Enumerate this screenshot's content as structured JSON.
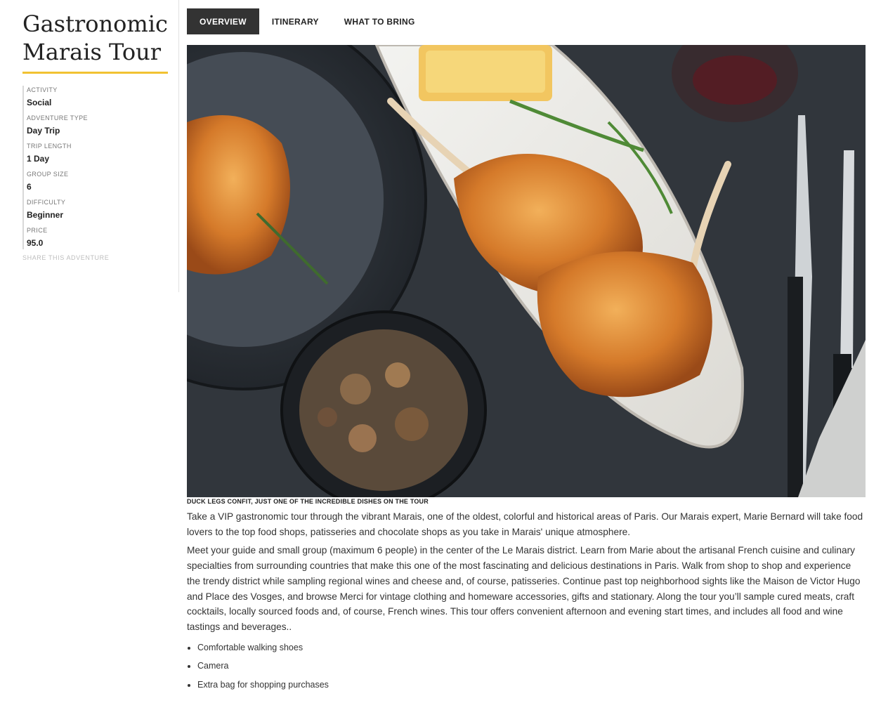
{
  "title": "Gastronomic Marais Tour",
  "facts": [
    {
      "label": "ACTIVITY",
      "value": "Social"
    },
    {
      "label": "ADVENTURE TYPE",
      "value": "Day Trip"
    },
    {
      "label": "TRIP LENGTH",
      "value": "1 Day"
    },
    {
      "label": "GROUP SIZE",
      "value": "6"
    },
    {
      "label": "DIFFICULTY",
      "value": "Beginner"
    },
    {
      "label": "PRICE",
      "value": "95.0"
    }
  ],
  "share_label": "SHARE THIS ADVENTURE",
  "tabs": [
    "OVERVIEW",
    "ITINERARY",
    "WHAT TO BRING"
  ],
  "active_tab": "OVERVIEW",
  "caption": "DUCK LEGS CONFIT, JUST ONE OF THE INCREDIBLE DISHES ON THE TOUR",
  "paragraphs": [
    "Take a VIP gastronomic tour through the vibrant Marais, one of the oldest, colorful and historical areas of Paris. Our Marais expert, Marie Bernard will take food lovers to the top food shops, patisseries and chocolate shops as you take in Marais' unique atmosphere.",
    "Meet your guide and small group (maximum 6 people) in the center of the Le Marais district. Learn from Marie about the artisanal French cuisine and culinary specialties from surrounding countries that make this one of the most fascinating and delicious destinations in Paris. Walk from shop to shop and experience the trendy district while sampling regional wines and cheese and, of course, patisseries. Continue past top neighborhood sights like the Maison de Victor Hugo and Place des Vosges, and browse Merci for vintage clothing and homeware accessories, gifts and stationary. Along the tour you’ll sample cured meats, craft cocktails, locally sourced foods and, of course, French wines. This tour offers convenient afternoon and evening start times, and includes all food and wine tastings and beverages.."
  ],
  "bring_items": [
    "Comfortable walking shoes",
    "Camera",
    "Extra bag for shopping purchases"
  ]
}
